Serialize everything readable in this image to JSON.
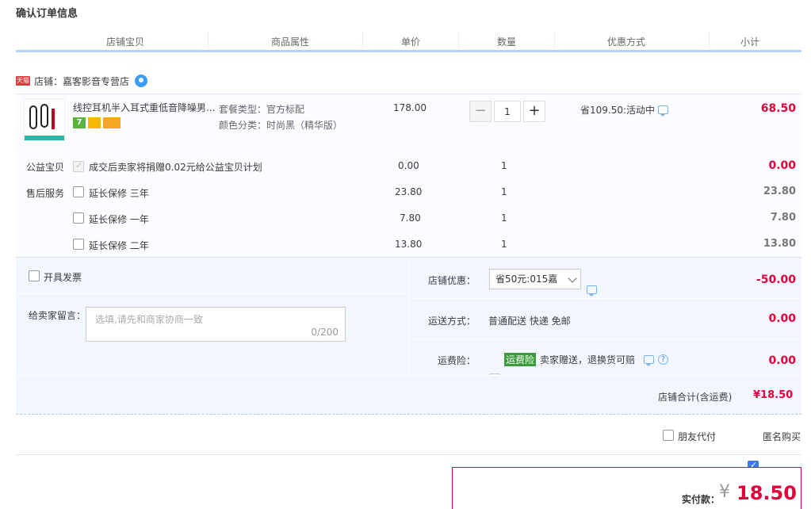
{
  "page_title": "确认订单信息",
  "columns": [
    "店铺宝贝",
    "商品属性",
    "单价",
    "数量",
    "优惠方式",
    "小计"
  ],
  "shop": {
    "badge": "天猫",
    "label": "店铺：嘉客影音专营店"
  },
  "item": {
    "title": "线控耳机半入耳式重低音降噪男...",
    "badges": [
      "7",
      "",
      ""
    ],
    "prop1": "套餐类型：官方标配",
    "prop2": "颜色分类：时尚黑（精华版）",
    "price": "178.00",
    "qty_minus": "−",
    "qty": "1",
    "qty_plus": "+",
    "promo": "省109.50:活动中",
    "subtotal": "68.50"
  },
  "charity": {
    "label": "公益宝贝",
    "text": "成交后卖家将捐赠0.02元给公益宝贝计划",
    "price": "0.00",
    "qty": "1",
    "subtotal": "0.00"
  },
  "services": {
    "label": "售后服务",
    "items": [
      {
        "name": "延长保修 三年",
        "price": "23.80",
        "qty": "1",
        "subtotal": "23.80"
      },
      {
        "name": "延长保修 一年",
        "price": "7.80",
        "qty": "1",
        "subtotal": "7.80"
      },
      {
        "name": "延长保修 二年",
        "price": "13.80",
        "qty": "1",
        "subtotal": "13.80"
      }
    ]
  },
  "invoice_label": "开具发票",
  "memo": {
    "label": "给卖家留言：",
    "placeholder": "选填,请先和商家协商一致",
    "count": "0/200"
  },
  "shop_discount": {
    "label": "店铺优惠：",
    "selected": "省50元:015嘉",
    "amount": "-50.00"
  },
  "delivery": {
    "label": "运送方式：",
    "value": "普通配送 快递 免邮",
    "amount": "0.00"
  },
  "insurance": {
    "label": "运费险：",
    "tag": "运费险",
    "text": "卖家赠送，退换货可赔",
    "help": "?",
    "amount": "0.00"
  },
  "shop_total": {
    "label": "店铺合计(含运费)",
    "amount": "¥18.50"
  },
  "options": {
    "friend_pay": "朋友代付",
    "anonymous": "匿名购买"
  },
  "payment": {
    "label": "实付款：",
    "currency": "¥",
    "amount": "18.50"
  },
  "colors": {
    "accent_red": "#e4003a",
    "header_border": "#b2d1ff",
    "panel_bg": "#f2f7ff"
  }
}
